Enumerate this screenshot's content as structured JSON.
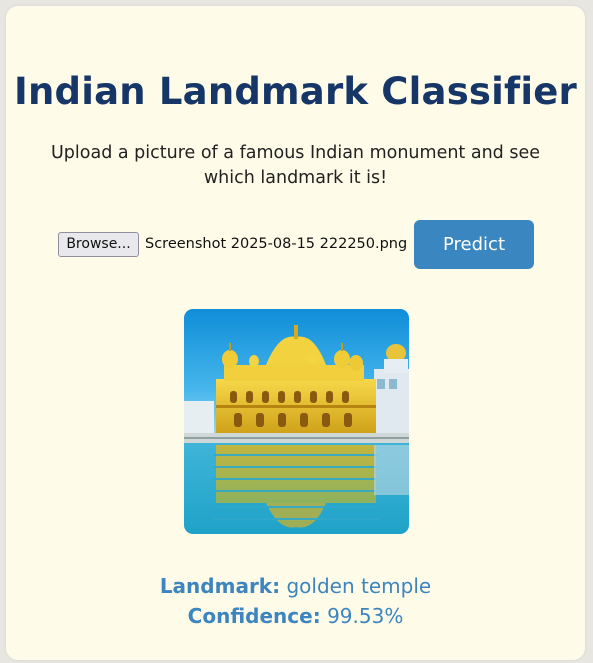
{
  "header": {
    "title": "Indian Landmark Classifier",
    "subtitle": "Upload a picture of a famous Indian monument and see which landmark it is!"
  },
  "upload": {
    "browse_label": "Browse...",
    "file_name": "Screenshot 2025-08-15 222250.png",
    "predict_label": "Predict"
  },
  "preview": {
    "image_subject": "golden-temple-photo"
  },
  "result": {
    "landmark_label": "Landmark:",
    "landmark_value": "golden temple",
    "confidence_label": "Confidence:",
    "confidence_value": "99.53%"
  },
  "colors": {
    "title": "#163667",
    "accent": "#3a86c0",
    "card_background": "#fefbe9",
    "page_background": "#e7e6e1"
  }
}
